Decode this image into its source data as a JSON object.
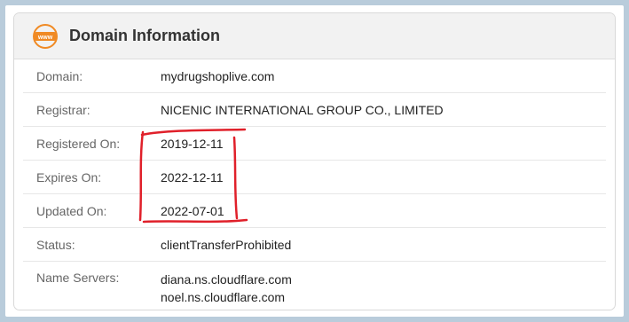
{
  "card": {
    "title": "Domain Information",
    "icon": "www-icon"
  },
  "rows": [
    {
      "label": "Domain:",
      "value": "mydrugshoplive.com"
    },
    {
      "label": "Registrar:",
      "value": "NICENIC INTERNATIONAL GROUP CO., LIMITED"
    },
    {
      "label": "Registered On:",
      "value": "2019-12-11"
    },
    {
      "label": "Expires On:",
      "value": "2022-12-11"
    },
    {
      "label": "Updated On:",
      "value": "2022-07-01"
    },
    {
      "label": "Status:",
      "value": "clientTransferProhibited"
    }
  ],
  "name_servers": {
    "label": "Name Servers:",
    "values": [
      "diana.ns.cloudflare.com",
      "noel.ns.cloudflare.com"
    ]
  },
  "colors": {
    "icon_orange": "#f08a24",
    "annotation_red": "#e0202a",
    "page_bg": "#b9ccdb"
  }
}
